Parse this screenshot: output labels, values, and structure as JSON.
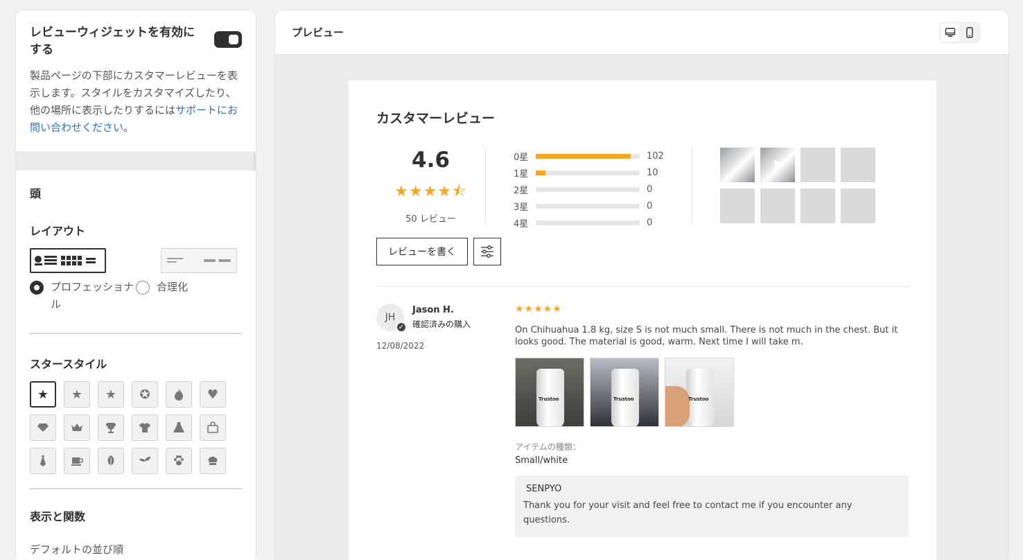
{
  "settings": {
    "enable_title": "レビューウィジェットを有効にする",
    "enable_desc": "製品ページの下部にカスタマーレビューを表示します。スタイルをカスタマイズしたり、他の場所に表示したりするには",
    "support_link": "サポートにお問い合わせください",
    "support_suffix": "。",
    "section_head": "頭",
    "layout_title": "レイアウト",
    "layout_options": [
      {
        "label": "プロフェッショナル",
        "selected": true
      },
      {
        "label": "合理化",
        "selected": false
      }
    ],
    "star_style_title": "スタースタイル",
    "star_styles": [
      "star-filled",
      "star",
      "star-thin",
      "star-badge",
      "flame",
      "heart",
      "diamond",
      "crown",
      "trophy",
      "shirt",
      "dress",
      "bag",
      "tie",
      "cup",
      "leaf",
      "sprout",
      "paw",
      "chef-hat"
    ],
    "display_title": "表示と関数",
    "sort_label": "デフォルトの並び順"
  },
  "preview": {
    "title": "プレビュー",
    "heading": "カスタマーレビュー",
    "average": "4.6",
    "average_stars": "★★★★⯪",
    "review_count": "50 レビュー",
    "bars": [
      {
        "label": "0星",
        "fraction": 0.91,
        "count": "102"
      },
      {
        "label": "1星",
        "fraction": 0.09,
        "count": "10"
      },
      {
        "label": "2星",
        "fraction": 0,
        "count": "0"
      },
      {
        "label": "3星",
        "fraction": 0,
        "count": "0"
      },
      {
        "label": "4星",
        "fraction": 0,
        "count": "0"
      }
    ],
    "write_button": "レビューを書く",
    "review": {
      "initials": "JH",
      "name": "Jason H.",
      "verified": "確認済みの購入",
      "date": "12/08/2022",
      "stars": "★★★★★",
      "text": "On Chihuahua 1.8 kg, size S is not much small. There is not much in the chest. But it looks good. The material is good, warm. Next time I will take m.",
      "photo_brand": "Trustoo",
      "item_type_label": "アイテムの種類：",
      "item_type_value": "Small/white",
      "reply_author": "SENPYO",
      "reply_text": "Thank you for your visit and feel free to contact me if you encounter any questions."
    }
  }
}
